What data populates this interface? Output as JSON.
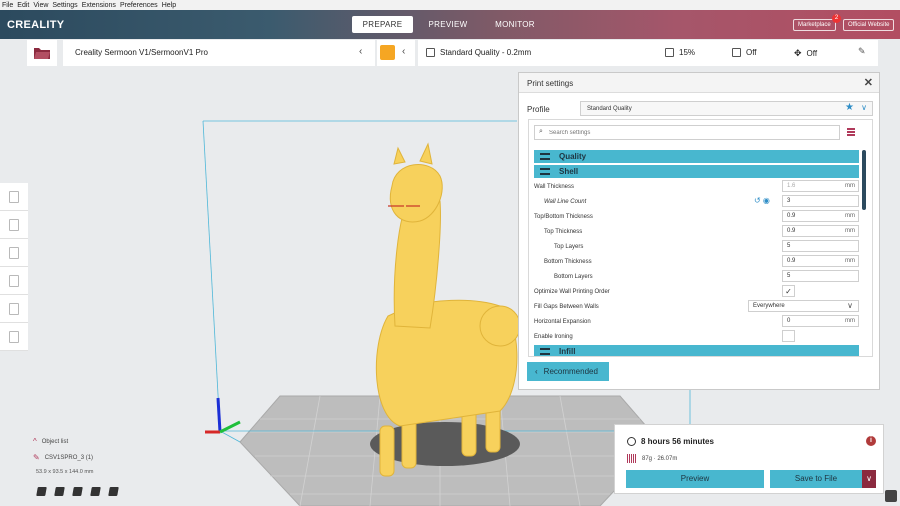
{
  "menu": [
    "File",
    "Edit",
    "View",
    "Settings",
    "Extensions",
    "Preferences",
    "Help"
  ],
  "header": {
    "logo": "CREALITY",
    "tabs": [
      "PREPARE",
      "PREVIEW",
      "MONITOR"
    ],
    "marketplace": "Marketplace",
    "marketplace_badge": "2",
    "website": "Official Website"
  },
  "toolbar": {
    "printer": "Creality Sermoon V1/SermoonV1 Pro",
    "quality": "Standard Quality - 0.2mm",
    "infill": "15%",
    "support": "Off",
    "adhesion": "Off"
  },
  "settings": {
    "title": "Print settings",
    "profile_label": "Profile",
    "profile_value": "Standard Quality",
    "search_placeholder": "Search settings",
    "categories": [
      "Quality",
      "Shell",
      "Infill"
    ],
    "rows": [
      {
        "label": "Wall Thickness",
        "value": "1.6",
        "unit": "mm"
      },
      {
        "label": "Wall Line Count",
        "value": "3",
        "unit": ""
      },
      {
        "label": "Top/Bottom Thickness",
        "value": "0.9",
        "unit": "mm"
      },
      {
        "label": "Top Thickness",
        "value": "0.9",
        "unit": "mm"
      },
      {
        "label": "Top Layers",
        "value": "5",
        "unit": ""
      },
      {
        "label": "Bottom Thickness",
        "value": "0.9",
        "unit": "mm"
      },
      {
        "label": "Bottom Layers",
        "value": "5",
        "unit": ""
      },
      {
        "label": "Optimize Wall Printing Order",
        "value": "✓",
        "unit": ""
      },
      {
        "label": "Fill Gaps Between Walls",
        "value": "Everywhere",
        "unit": ""
      },
      {
        "label": "Horizontal Expansion",
        "value": "0",
        "unit": "mm"
      },
      {
        "label": "Enable Ironing",
        "value": "",
        "unit": ""
      }
    ],
    "recommended": "Recommended"
  },
  "objects": {
    "list_label": "Object list",
    "object_name": "CSV1SPRO_3 (1)",
    "dimensions": "53.9 x 93.5 x 144.0 mm"
  },
  "print": {
    "time": "8 hours 56 minutes",
    "material": "87g · 26.07m",
    "preview": "Preview",
    "save": "Save to File"
  },
  "colors": {
    "accent": "#48b7cf",
    "brand_dark": "#2c4a5e",
    "brand_red": "#b03a5b",
    "model": "#f7d15c"
  }
}
